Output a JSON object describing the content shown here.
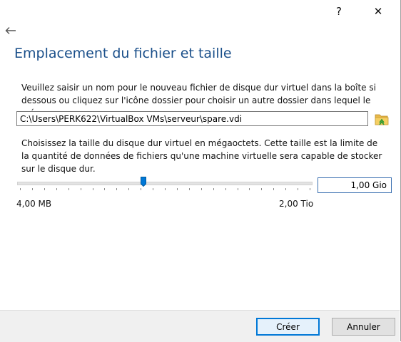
{
  "titlebar": {
    "help_label": "?",
    "close_label": "✕"
  },
  "page": {
    "title": "Emplacement du fichier et taille"
  },
  "file_location": {
    "description": "Veuillez saisir un nom pour le nouveau fichier de disque dur virtuel dans la boîte si dessous ou cliquez sur l'icône dossier pour choisir un autre dossier dans lequel le créer.",
    "path_value": "C:\\Users\\PERK622\\VirtualBox VMs\\serveur\\spare.vdi",
    "folder_icon": "folder-icon"
  },
  "file_size": {
    "description": "Choisissez la taille du disque dur virtuel en mégaoctets. Cette taille est la limite de la quantité de données de fichiers qu'une machine virtuelle sera capable de stocker sur le disque dur.",
    "size_value": "1,00 Gio",
    "slider_position": 0.425,
    "min_label": "4,00 MB",
    "max_label": "2,00 Tio"
  },
  "footer": {
    "create_label": "Créer",
    "cancel_label": "Annuler"
  },
  "colors": {
    "title": "#1a4f8a",
    "accent": "#0078d7",
    "footer_bg": "#f0f0f0"
  }
}
